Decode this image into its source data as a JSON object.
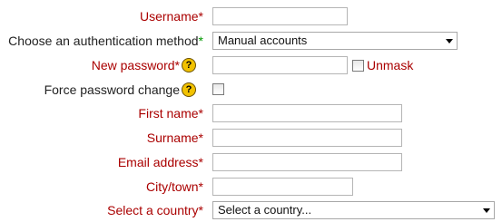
{
  "form": {
    "username": {
      "label": "Username",
      "required_mark": "*",
      "value": ""
    },
    "auth_method": {
      "label": "Choose an authentication method",
      "required_mark": "*",
      "selected": "Manual accounts"
    },
    "new_password": {
      "label": "New password",
      "required_mark": "*",
      "value": "",
      "help_icon": "question-icon",
      "unmask_label": "Unmask",
      "unmask_checked": false
    },
    "force_password_change": {
      "label": "Force password change",
      "help_icon": "question-icon",
      "checked": false
    },
    "first_name": {
      "label": "First name",
      "required_mark": "*",
      "value": ""
    },
    "surname": {
      "label": "Surname",
      "required_mark": "*",
      "value": ""
    },
    "email": {
      "label": "Email address",
      "required_mark": "*",
      "value": ""
    },
    "city": {
      "label": "City/town",
      "required_mark": "*",
      "value": ""
    },
    "country": {
      "label": "Select a country",
      "required_mark": "*",
      "selected": "Select a country..."
    }
  },
  "colors": {
    "required_label": "#aa0000",
    "required_star": "#aa0000",
    "optional_star": "#009900",
    "help_icon": "#f2c200"
  },
  "help_glyph": "?"
}
